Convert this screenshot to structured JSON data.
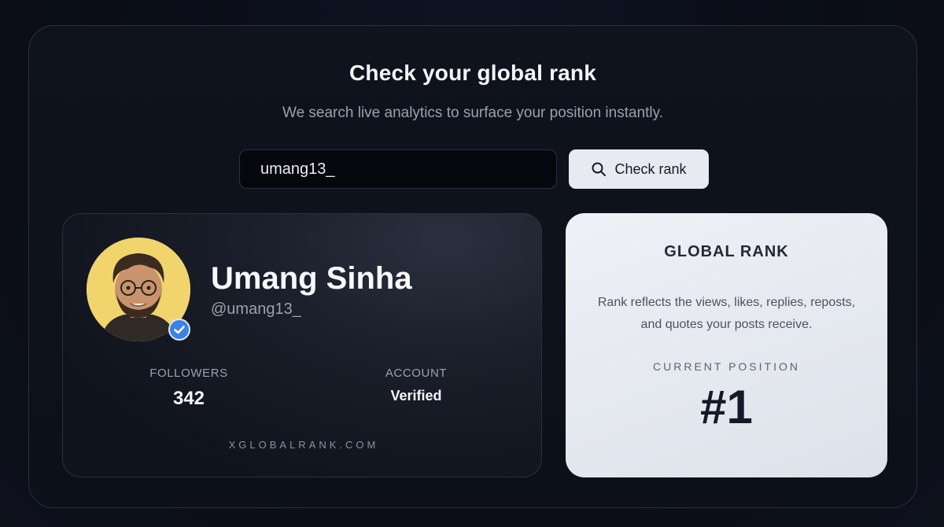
{
  "header": {
    "title": "Check your global rank",
    "subtitle": "We search live analytics to surface your position instantly."
  },
  "search": {
    "value": "umang13_",
    "button_label": "Check rank",
    "button_icon": "search-icon"
  },
  "profile": {
    "name": "Umang Sinha",
    "handle": "@umang13_",
    "avatar_bg": "#f1d56c",
    "verified_icon": "verified-badge-icon",
    "stats": {
      "followers_label": "FOLLOWERS",
      "followers_value": "342",
      "account_label": "ACCOUNT",
      "account_value": "Verified"
    },
    "site": "XGLOBALRANK.COM"
  },
  "rank": {
    "heading": "GLOBAL RANK",
    "description": "Rank reflects the views, likes, replies, reposts, and quotes your posts receive.",
    "position_label": "CURRENT POSITION",
    "position_value": "#1"
  },
  "colors": {
    "background": "#0a0d17",
    "accent_light": "#e7eaf1",
    "verified_blue": "#3b82e6"
  }
}
